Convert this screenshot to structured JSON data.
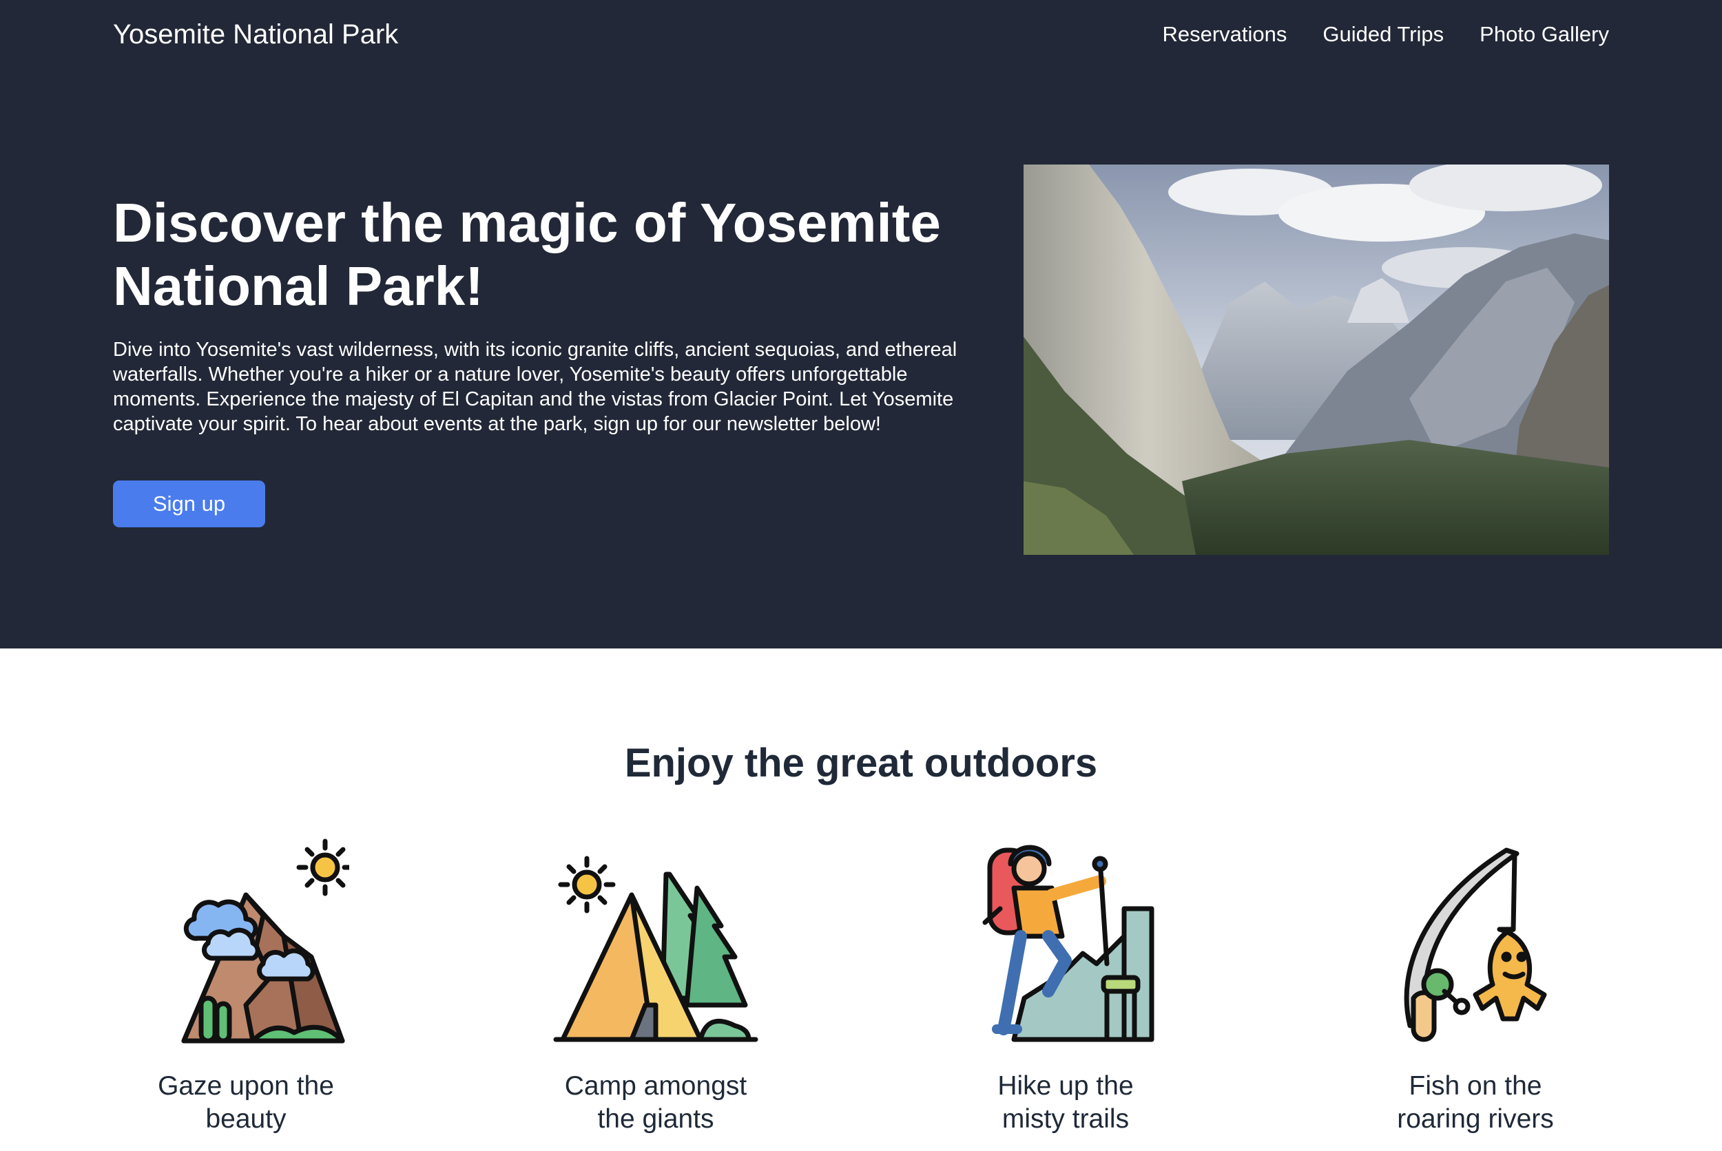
{
  "header": {
    "brand": "Yosemite National Park",
    "nav": [
      "Reservations",
      "Guided Trips",
      "Photo Gallery"
    ]
  },
  "hero": {
    "title": "Discover the magic of Yosemite National Park!",
    "description": "Dive into Yosemite's vast wilderness, with its iconic granite cliffs, ancient sequoias, and ethereal waterfalls. Whether you're a hiker or a nature lover, Yosemite's beauty offers unforgettable moments. Experience the majesty of El Capitan and the vistas from Glacier Point. Let Yosemite captivate your spirit. To hear about events at the park, sign up for our newsletter below!",
    "cta_label": "Sign up",
    "image_icon": "valley-photo"
  },
  "features": {
    "title": "Enjoy the great outdoors",
    "items": [
      {
        "line1": "Gaze upon the",
        "line2": "beauty",
        "icon": "mountain-icon"
      },
      {
        "line1": "Camp amongst",
        "line2": "the giants",
        "icon": "tent-icon"
      },
      {
        "line1": "Hike up the",
        "line2": "misty trails",
        "icon": "hiker-icon"
      },
      {
        "line1": "Fish on the",
        "line2": "roaring rivers",
        "icon": "fishing-icon"
      }
    ]
  },
  "colors": {
    "hero_bg": "#222837",
    "button": "#4a7ced",
    "heading": "#1f2937"
  }
}
